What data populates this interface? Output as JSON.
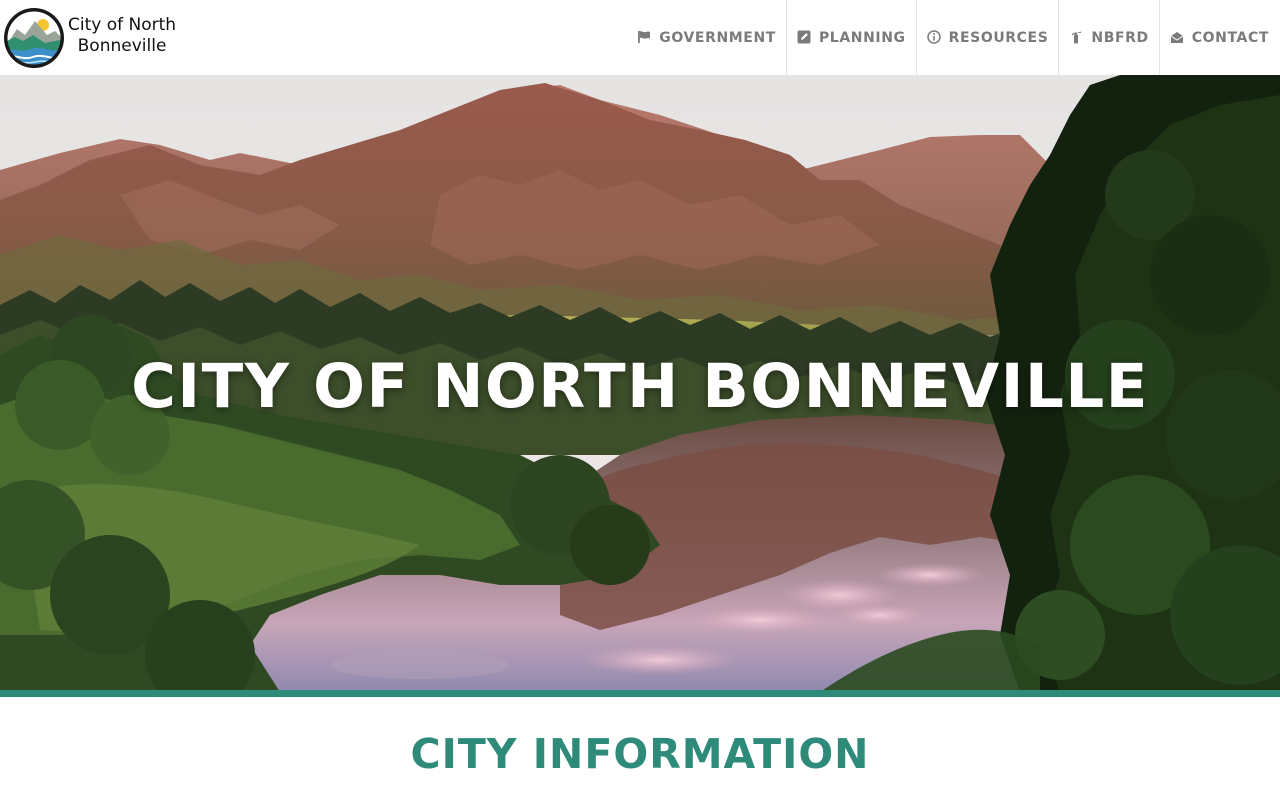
{
  "brand": {
    "name_line1": "City of North",
    "name_line2": "Bonneville",
    "logo_icon": "city-seal-logo"
  },
  "nav": {
    "items": [
      {
        "label": "GOVERNMENT",
        "icon": "flag-icon"
      },
      {
        "label": "PLANNING",
        "icon": "edit-square-icon"
      },
      {
        "label": "RESOURCES",
        "icon": "info-circle-icon"
      },
      {
        "label": "NBFRD",
        "icon": "fire-extinguisher-icon"
      },
      {
        "label": "CONTACT",
        "icon": "open-envelope-icon"
      }
    ]
  },
  "hero": {
    "title": "CITY OF NORTH BONNEVILLE"
  },
  "section": {
    "title": "CITY INFORMATION"
  },
  "colors": {
    "accent": "#2e8b7a",
    "nav_text": "#7b7b7b",
    "hero_text": "#ffffff"
  }
}
